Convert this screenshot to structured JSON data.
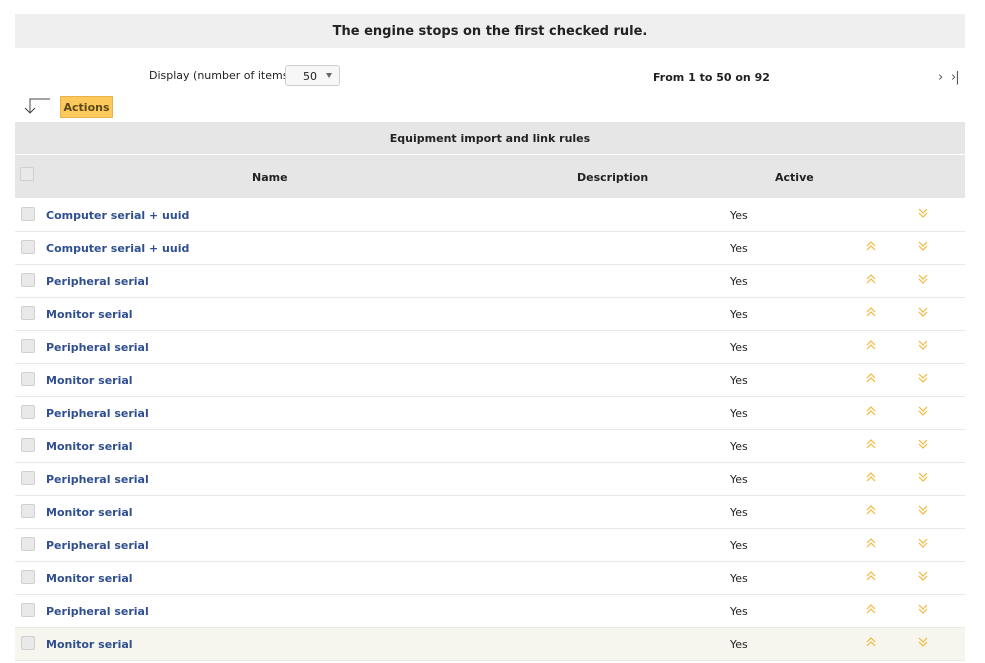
{
  "notice": "The engine stops on the first checked rule.",
  "display": {
    "label": "Display (number of items)",
    "value": "50"
  },
  "pager": {
    "info": "From 1 to 50 on 92",
    "next": "›",
    "last": "›|"
  },
  "actions_label": "Actions",
  "table": {
    "title": "Equipment import and link rules",
    "headers": {
      "name": "Name",
      "description": "Description",
      "active": "Active"
    },
    "rows": [
      {
        "name": "Computer serial + uuid",
        "active": "Yes"
      },
      {
        "name": "Computer serial + uuid",
        "active": "Yes"
      },
      {
        "name": "Peripheral serial",
        "active": "Yes"
      },
      {
        "name": "Monitor serial",
        "active": "Yes"
      },
      {
        "name": "Peripheral serial",
        "active": "Yes"
      },
      {
        "name": "Monitor serial",
        "active": "Yes"
      },
      {
        "name": "Peripheral serial",
        "active": "Yes"
      },
      {
        "name": "Monitor serial",
        "active": "Yes"
      },
      {
        "name": "Peripheral serial",
        "active": "Yes"
      },
      {
        "name": "Monitor serial",
        "active": "Yes"
      },
      {
        "name": "Peripheral serial",
        "active": "Yes"
      },
      {
        "name": "Monitor serial",
        "active": "Yes"
      },
      {
        "name": "Peripheral serial",
        "active": "Yes"
      },
      {
        "name": "Monitor serial",
        "active": "Yes"
      }
    ]
  },
  "colors": {
    "accent": "#fec95c",
    "link": "#2f4f8f",
    "arrow": "#f0b93a"
  },
  "icons": {
    "move_up": "double-chevron-up-icon",
    "move_down": "double-chevron-down-icon",
    "batch": "arrow-down-left-icon"
  }
}
